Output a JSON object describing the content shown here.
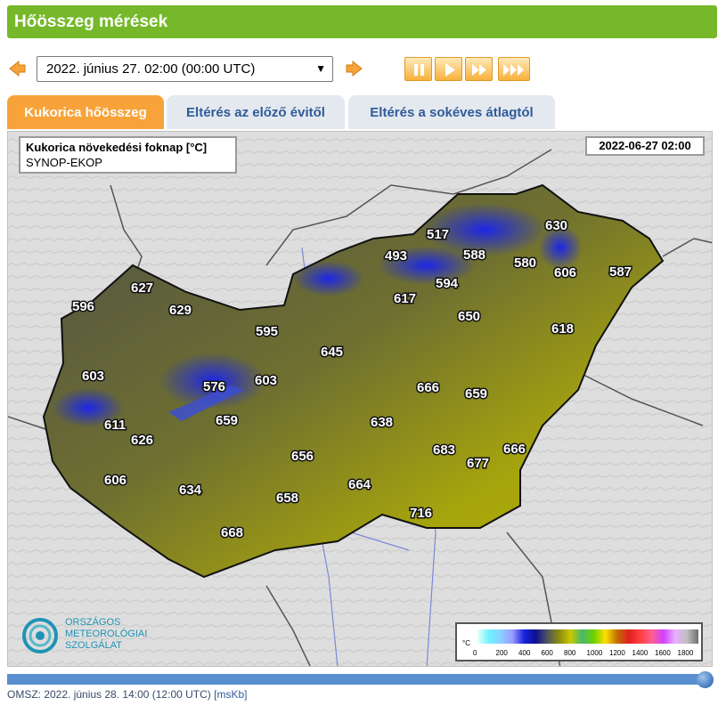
{
  "header": {
    "title": "Hőösszeg mérések"
  },
  "controls": {
    "selected_time": "2022. június 27. 02:00 (00:00  UTC)"
  },
  "tabs": [
    {
      "label": "Kukorica hőösszeg",
      "active": true
    },
    {
      "label": "Eltérés az előző évitől",
      "active": false
    },
    {
      "label": "Eltérés a sokéves átlagtól",
      "active": false
    }
  ],
  "map": {
    "legend_title": "Kukorica növekedési foknap [°C]",
    "legend_source": "SYNOP-EKOP",
    "date_label": "2022-06-27 02:00",
    "scale_unit": "°C",
    "scale_ticks": [
      "0",
      "200",
      "400",
      "600",
      "800",
      "1000",
      "1200",
      "1400",
      "1600",
      "1800"
    ],
    "values": [
      "630",
      "517",
      "580",
      "493",
      "588",
      "627",
      "596",
      "629",
      "606",
      "587",
      "617",
      "594",
      "650",
      "618",
      "595",
      "645",
      "603",
      "576",
      "603",
      "666",
      "659",
      "611",
      "638",
      "626",
      "659",
      "656",
      "683",
      "666",
      "677",
      "606",
      "634",
      "664",
      "658",
      "716",
      "668"
    ],
    "colors": {
      "low": "#2028d8",
      "mid": "#5b5d4a",
      "high": "#a8a800"
    }
  },
  "logo": {
    "line1": "ORSZÁGOS",
    "line2": "METEOROLÓGIAI",
    "line3": "SZOLGÁLAT"
  },
  "footer": {
    "text": "OMSZ: 2022. június 28. 14:00 (12:00  UTC)",
    "link": "[msKb]"
  }
}
